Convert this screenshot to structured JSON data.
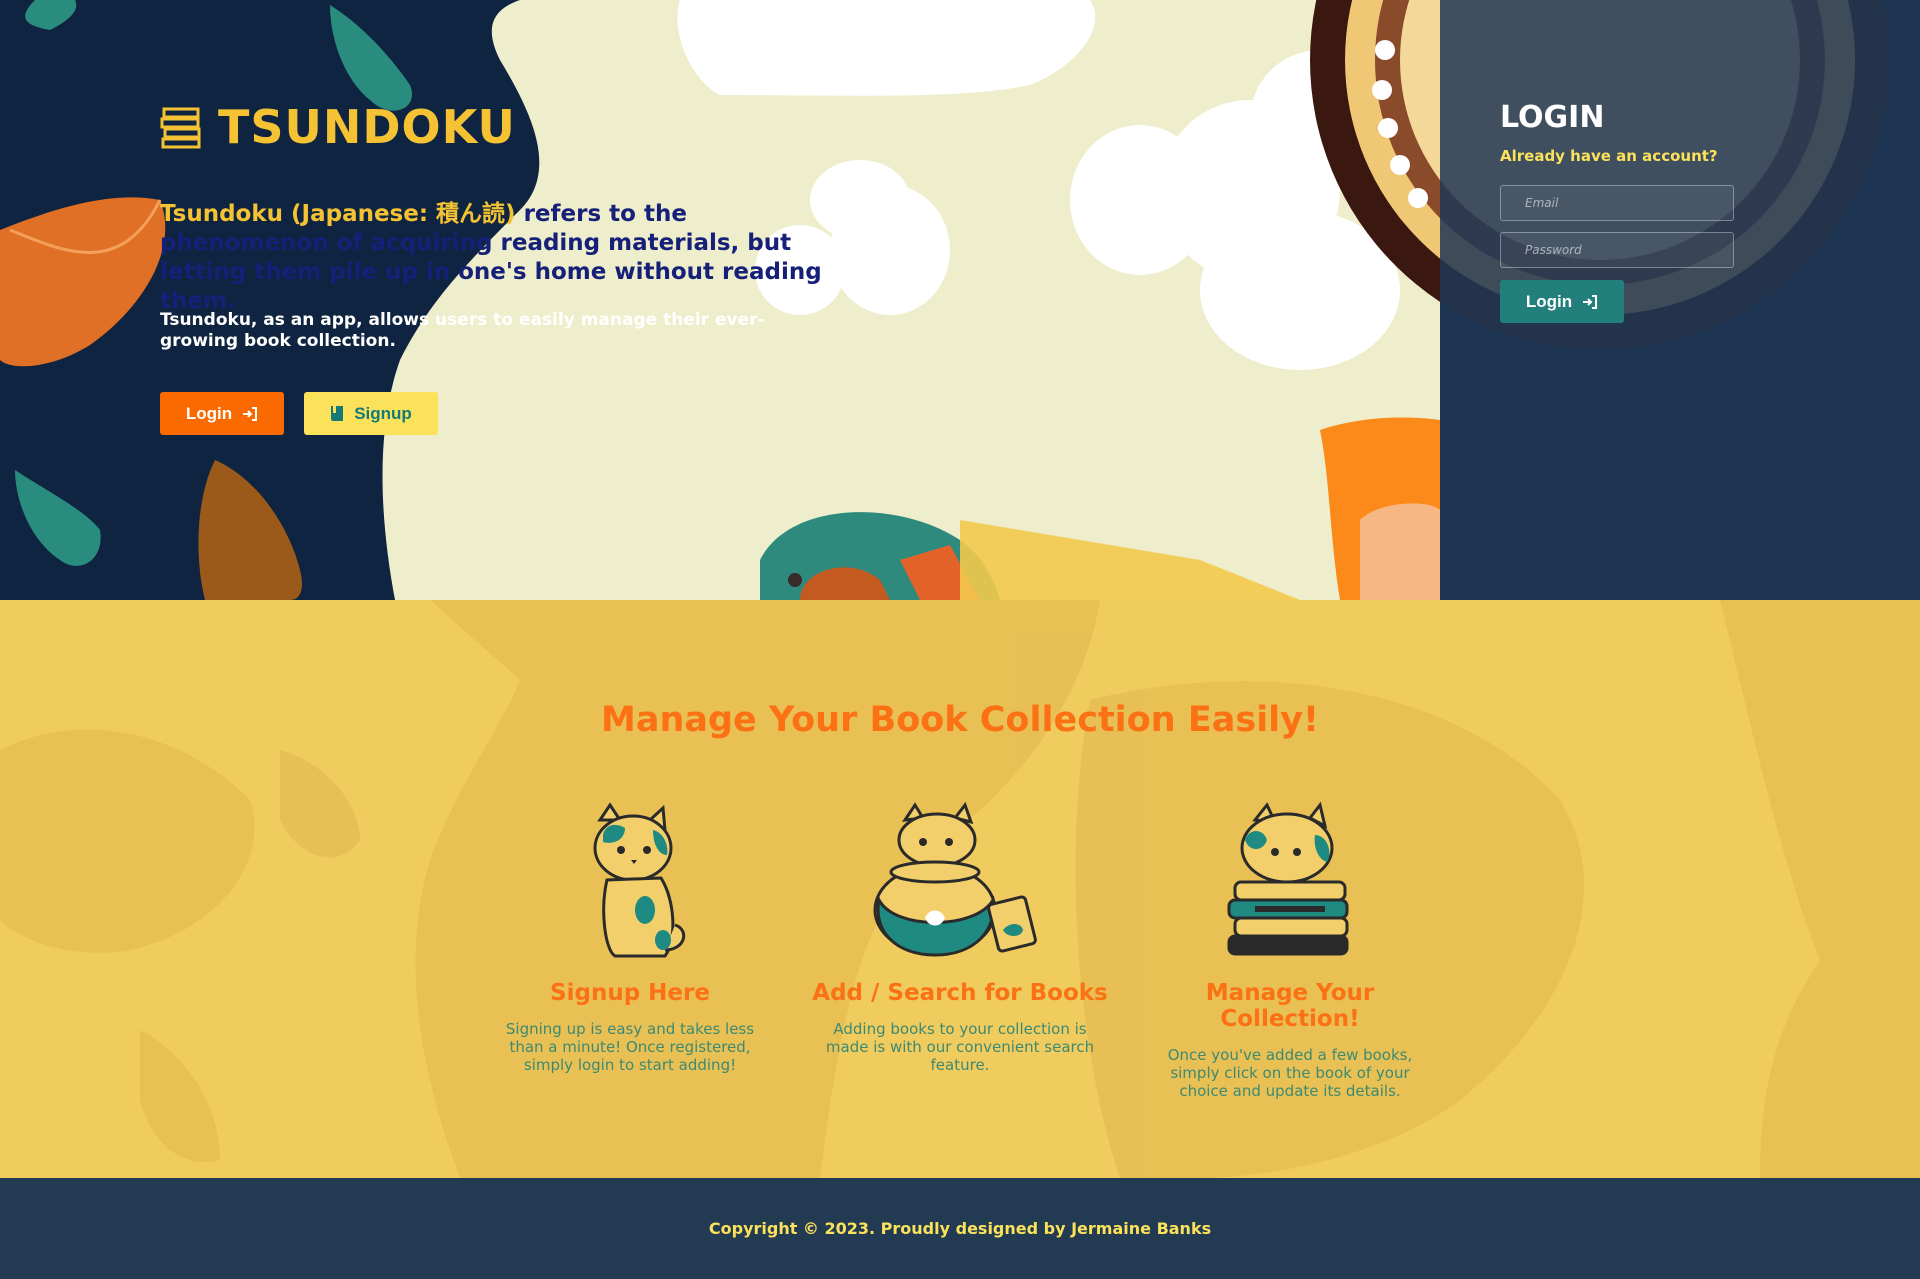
{
  "brand": {
    "name": "TSUNDOKU",
    "icon": "books-stack-icon"
  },
  "hero": {
    "tagline_part1": "Tsundoku (Japanese: 積ん読) ",
    "tagline_part2": "refers to the phenomenon of acquiring reading materials, but letting them pile up in one's home without reading them.",
    "description": "Tsundoku, as an app, allows users to easily manage their ever-growing book collection.",
    "login_label": "Login",
    "signup_label": "Signup"
  },
  "login_panel": {
    "title": "LOGIN",
    "subtitle": "Already have an account?",
    "email_placeholder": "Email",
    "password_placeholder": "Password",
    "button_label": "Login"
  },
  "features": {
    "title": "Manage Your Book Collection Easily!",
    "items": [
      {
        "title": "Signup Here",
        "text": "Signing up is easy and takes less than a minute! Once registered, simply login to start adding!",
        "icon": "sitting-cat-icon"
      },
      {
        "title": "Add / Search for Books",
        "text": "Adding books to your collection is made is with our convenient search feature.",
        "icon": "cat-in-fishbowl-icon"
      },
      {
        "title": "Manage Your Collection!",
        "text": "Once you've added a few books, simply click on the book of your choice and update its details.",
        "icon": "cat-on-books-icon"
      }
    ]
  },
  "footer": {
    "copyright": "Copyright © 2023. Proudly designed by Jermaine Banks"
  },
  "colors": {
    "navy": "#0f2440",
    "yellow": "#f4c233",
    "orange": "#fb6a00",
    "teal": "#227f7b",
    "section_yellow": "#f0cb5d",
    "footer": "#223a52"
  }
}
